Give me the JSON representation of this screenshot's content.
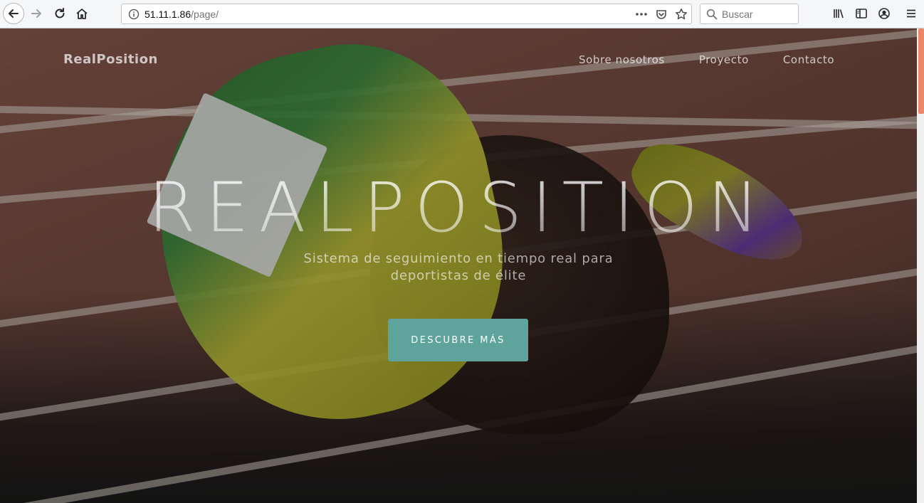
{
  "browser": {
    "url_host": "51.11.1.86",
    "url_path": "/page/",
    "search_placeholder": "Buscar",
    "icons": {
      "back": "back-arrow-icon",
      "forward": "forward-arrow-icon",
      "reload": "reload-icon",
      "home": "home-icon",
      "info": "info-icon",
      "more": "more-icon",
      "pocket": "pocket-icon",
      "bookmark": "star-icon",
      "search": "search-icon",
      "library": "library-icon",
      "sidebar": "sidebar-icon",
      "account": "account-icon",
      "menu": "hamburger-menu-icon"
    }
  },
  "page": {
    "brand": "RealPosition",
    "nav": [
      {
        "label": "Sobre nosotros"
      },
      {
        "label": "Proyecto"
      },
      {
        "label": "Contacto"
      }
    ],
    "hero": {
      "title": "REALPOSITION",
      "subtitle": "Sistema de seguimiento en tiempo real para deportistas de élite",
      "cta": "DESCUBRE MÁS"
    },
    "colors": {
      "cta": "#5ea39c",
      "scroll_thumb": "#e9896a"
    }
  }
}
